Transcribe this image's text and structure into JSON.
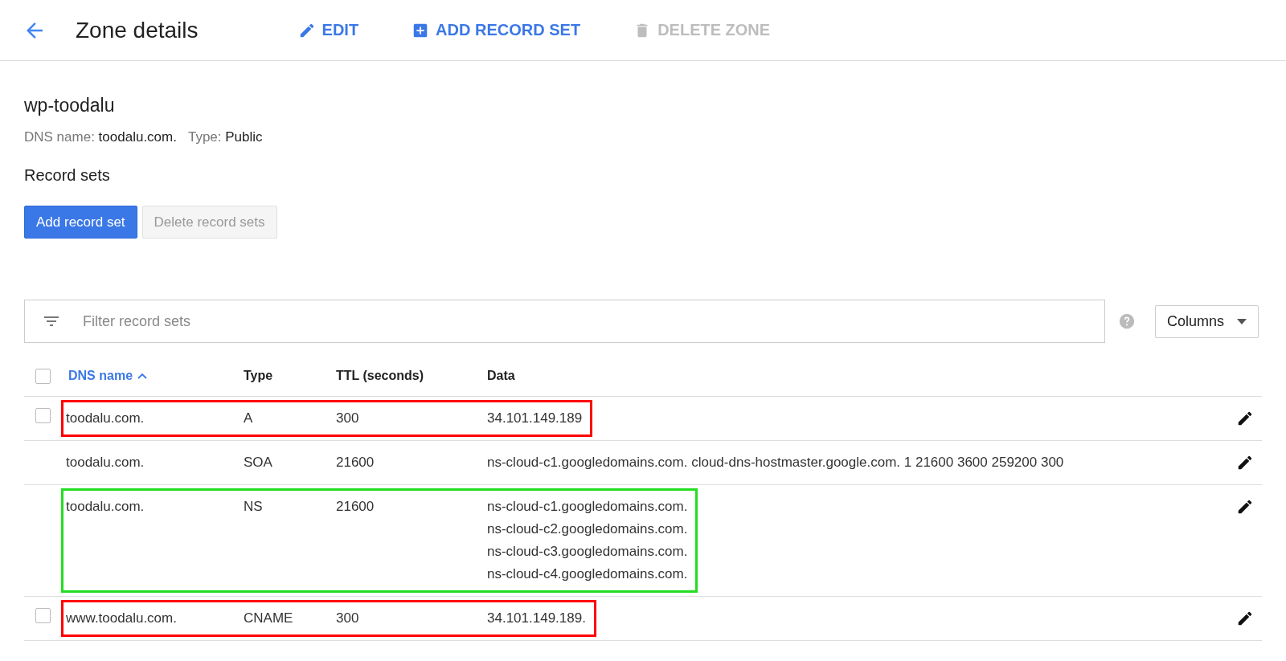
{
  "header": {
    "title": "Zone details",
    "actions": [
      {
        "kind": "edit",
        "label": "EDIT",
        "disabled": false
      },
      {
        "kind": "add",
        "label": "ADD RECORD SET",
        "disabled": false
      },
      {
        "kind": "delete",
        "label": "DELETE ZONE",
        "disabled": true
      }
    ]
  },
  "zone": {
    "name": "wp-toodalu",
    "meta": [
      {
        "label": "DNS name:",
        "value": "toodalu.com."
      },
      {
        "label": "Type:",
        "value": "Public"
      }
    ]
  },
  "record_sets": {
    "title": "Record sets",
    "buttons": [
      {
        "label": "Add record set",
        "primary": true,
        "disabled": false
      },
      {
        "label": "Delete record sets",
        "primary": false,
        "disabled": true
      }
    ]
  },
  "filter": {
    "placeholder": "Filter record sets"
  },
  "columns_button": {
    "label": "Columns"
  },
  "table": {
    "header_checked": false,
    "columns": [
      {
        "label": "DNS name",
        "sorted": true
      },
      {
        "label": "Type",
        "sorted": false
      },
      {
        "label": "TTL (seconds)",
        "sorted": false
      },
      {
        "label": "Data",
        "sorted": false
      }
    ],
    "rows": [
      {
        "selectable": true,
        "checked": false,
        "name": "toodalu.com.",
        "type": "A",
        "ttl": "300",
        "data": [
          "34.101.149.189"
        ],
        "color": "#ff0000"
      },
      {
        "selectable": false,
        "name": "toodalu.com.",
        "type": "SOA",
        "ttl": "21600",
        "data": [
          "ns-cloud-c1.googledomains.com. cloud-dns-hostmaster.google.com. 1 21600 3600 259200 300"
        ]
      },
      {
        "selectable": false,
        "name": "toodalu.com.",
        "type": "NS",
        "ttl": "21600",
        "data": [
          "ns-cloud-c1.googledomains.com.",
          "ns-cloud-c2.googledomains.com.",
          "ns-cloud-c3.googledomains.com.",
          "ns-cloud-c4.googledomains.com."
        ],
        "color": "#22dd22"
      },
      {
        "selectable": true,
        "checked": false,
        "name": "www.toodalu.com.",
        "type": "CNAME",
        "ttl": "300",
        "data": [
          "34.101.149.189."
        ],
        "color": "#ff0000"
      }
    ]
  }
}
